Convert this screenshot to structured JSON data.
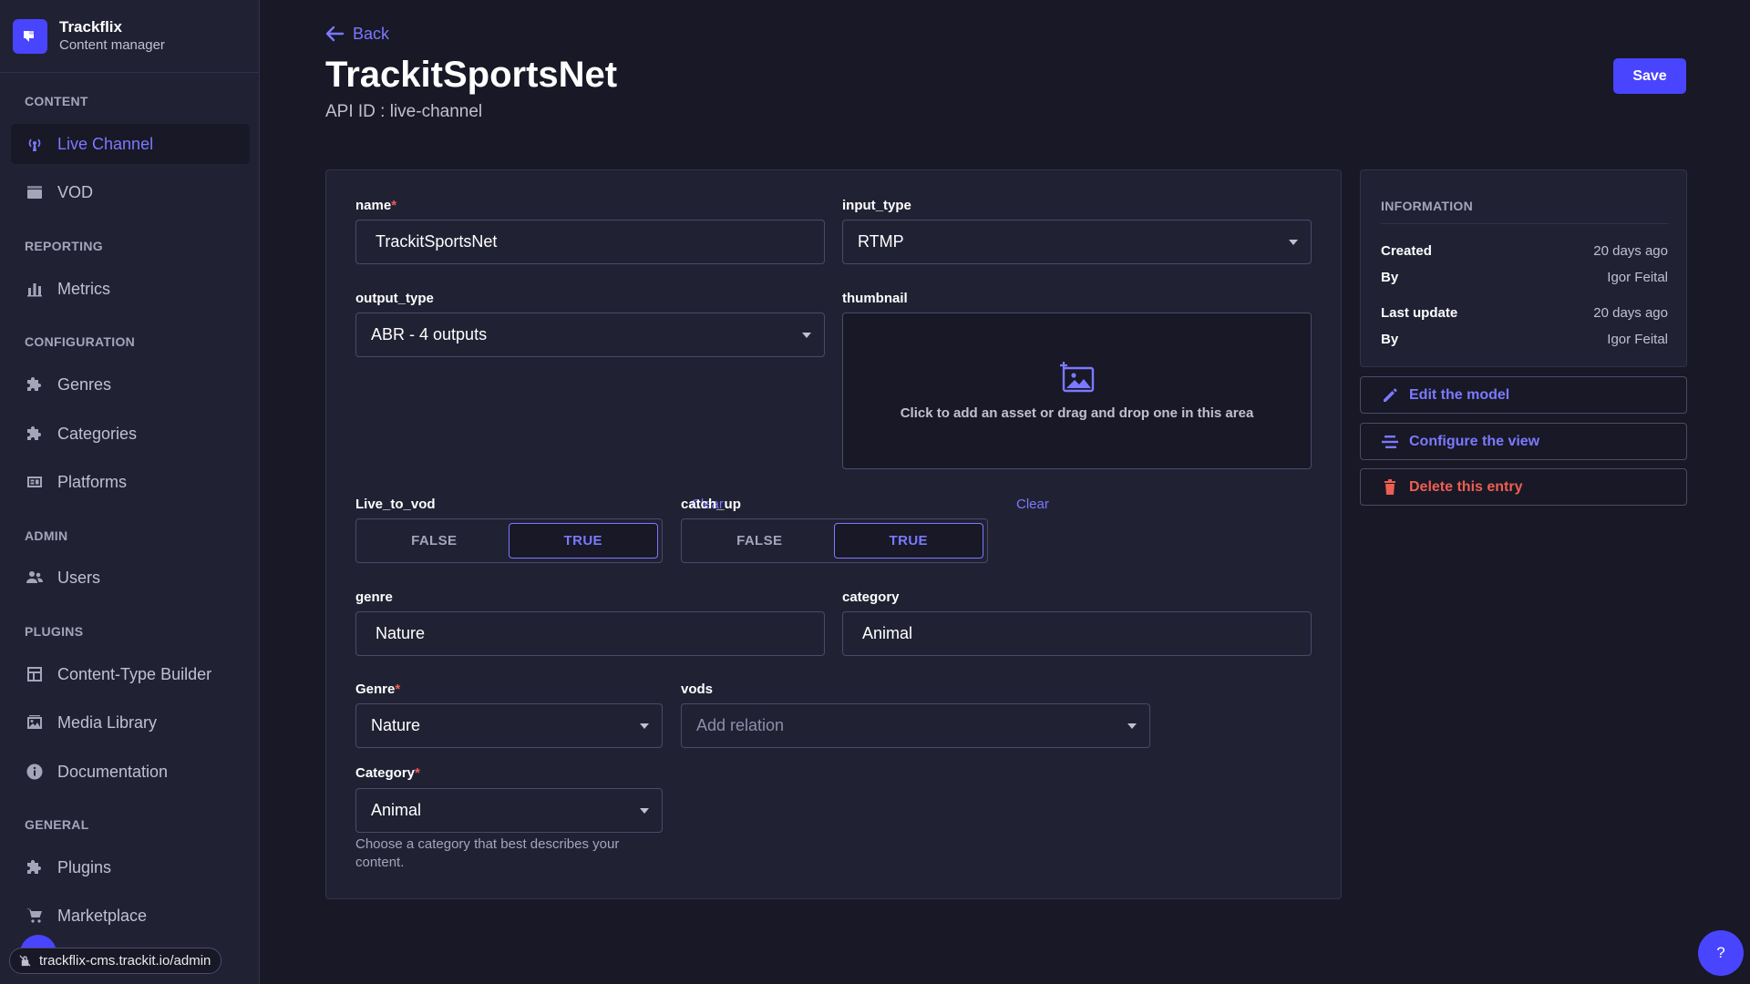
{
  "brand": {
    "title": "Trackflix",
    "subtitle": "Content manager"
  },
  "sidebar": {
    "sections": [
      {
        "label": "CONTENT"
      },
      {
        "label": "REPORTING"
      },
      {
        "label": "CONFIGURATION"
      },
      {
        "label": "ADMIN"
      },
      {
        "label": "PLUGINS"
      },
      {
        "label": "GENERAL"
      }
    ],
    "items": [
      {
        "label": "Live Channel",
        "icon": "broadcast-icon",
        "active": true
      },
      {
        "label": "VOD",
        "icon": "clapperboard-icon"
      },
      {
        "label": "Metrics",
        "icon": "bar-chart-icon"
      },
      {
        "label": "Genres",
        "icon": "puzzle-icon"
      },
      {
        "label": "Categories",
        "icon": "puzzle-icon"
      },
      {
        "label": "Platforms",
        "icon": "platform-icon"
      },
      {
        "label": "Users",
        "icon": "users-icon"
      },
      {
        "label": "Content-Type Builder",
        "icon": "layout-icon"
      },
      {
        "label": "Media Library",
        "icon": "image-icon"
      },
      {
        "label": "Documentation",
        "icon": "info-icon"
      },
      {
        "label": "Plugins",
        "icon": "puzzle-icon"
      },
      {
        "label": "Marketplace",
        "icon": "cart-icon"
      }
    ],
    "url_tooltip": "trackflix-cms.trackit.io/admin"
  },
  "header": {
    "back_label": "Back",
    "title": "TrackitSportsNet",
    "api_id": "API ID : live-channel",
    "save_label": "Save"
  },
  "form": {
    "name": {
      "label": "name",
      "value": "TrackitSportsNet"
    },
    "input_type": {
      "label": "input_type",
      "value": "RTMP"
    },
    "output_type": {
      "label": "output_type",
      "value": "ABR - 4 outputs"
    },
    "thumbnail": {
      "label": "thumbnail",
      "text": "Click to add an asset or drag and drop one in this area"
    },
    "live_to_vod": {
      "label": "Live_to_vod",
      "clear": "Clear",
      "false_label": "FALSE",
      "true_label": "TRUE",
      "selected": "TRUE"
    },
    "catch_up": {
      "label": "catch_up",
      "clear": "Clear",
      "false_label": "FALSE",
      "true_label": "TRUE",
      "selected": "TRUE"
    },
    "genre_text": {
      "label": "genre",
      "value": "Nature"
    },
    "category_text": {
      "label": "category",
      "value": "Animal"
    },
    "genre_rel": {
      "label": "Genre",
      "value": "Nature"
    },
    "vods": {
      "label": "vods",
      "placeholder": "Add relation"
    },
    "category_rel": {
      "label": "Category",
      "value": "Animal",
      "hint": "Choose a category that best describes your content."
    }
  },
  "info": {
    "title": "INFORMATION",
    "created_label": "Created",
    "created_value": "20 days ago",
    "by_label": "By",
    "created_by": "Igor Feital",
    "updated_label": "Last update",
    "updated_value": "20 days ago",
    "updated_by": "Igor Feital"
  },
  "actions": {
    "edit_model": "Edit the model",
    "configure_view": "Configure the view",
    "delete_entry": "Delete this entry"
  },
  "help": {
    "label": "?"
  },
  "colors": {
    "accent": "#7b79ff",
    "primary": "#4945ff",
    "danger": "#ee5e52",
    "bg": "#181826",
    "panel": "#212134"
  }
}
